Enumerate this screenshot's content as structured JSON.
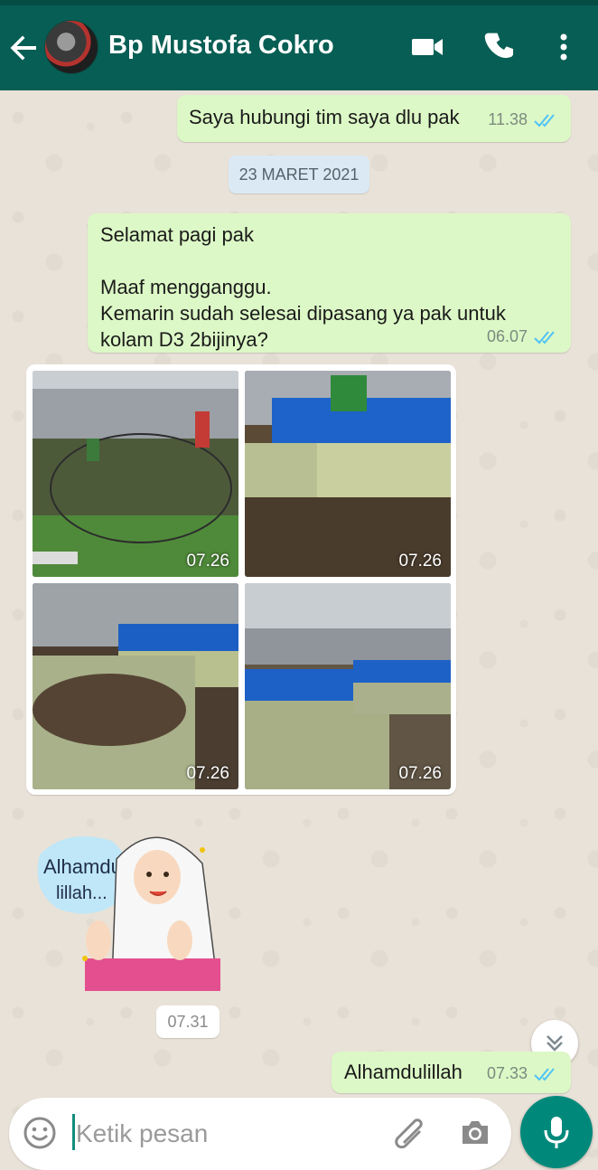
{
  "header": {
    "contact_name": "Bp Mustofa Cokro",
    "background_color": "#075e54",
    "icons": [
      "back-arrow-icon",
      "video-call-icon",
      "voice-call-icon",
      "more-options-icon"
    ]
  },
  "messages": [
    {
      "direction": "out",
      "text": "Saya hubungi tim saya dlu pak",
      "time": "11.38",
      "status": "read"
    },
    {
      "type": "date",
      "text": "23 MARET 2021"
    },
    {
      "direction": "out",
      "text": "Selamat pagi pak\n\nMaaf mengganggu.\nKemarin sudah selesai dipasang ya pak untuk\nkolam D3 2bijinya?",
      "time": "06.07",
      "status": "read"
    },
    {
      "direction": "in",
      "type": "photo-album",
      "photos": [
        {
          "time": "07.26"
        },
        {
          "time": "07.26"
        },
        {
          "time": "07.26"
        },
        {
          "time": "07.26"
        }
      ]
    },
    {
      "direction": "in",
      "type": "sticker",
      "sticker_text": "Alhamdu lillah...",
      "time": "07.31"
    },
    {
      "direction": "out",
      "text": "Alhamdulillah",
      "time": "07.33",
      "status": "read"
    }
  ],
  "composer": {
    "placeholder": "Ketik pesan",
    "icons": [
      "emoji-icon",
      "attach-icon",
      "camera-icon",
      "mic-icon"
    ]
  },
  "colors": {
    "outgoing_bubble": "#dcf8c6",
    "incoming_bubble": "#ffffff",
    "read_ticks": "#4fc3f7",
    "accent": "#00897b"
  }
}
